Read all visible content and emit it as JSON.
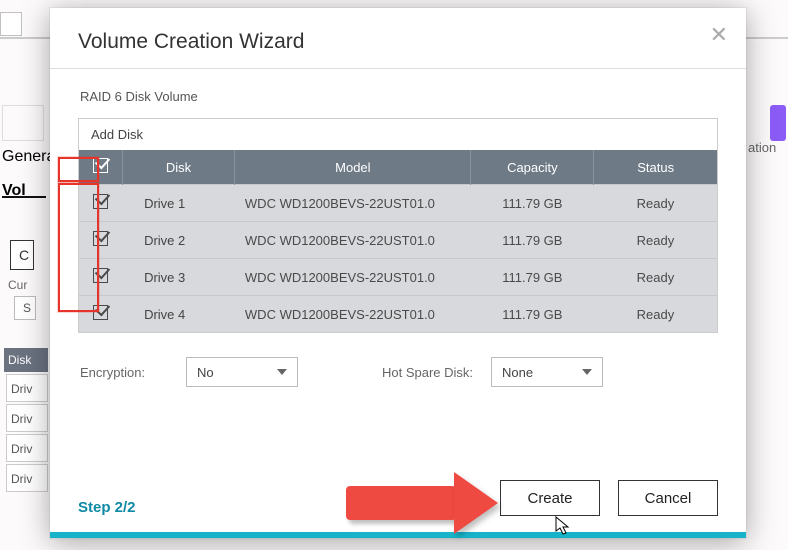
{
  "modal": {
    "title": "Volume Creation Wizard",
    "subtitle": "RAID 6 Disk Volume",
    "add_disk_label": "Add Disk",
    "columns": {
      "disk": "Disk",
      "model": "Model",
      "capacity": "Capacity",
      "status": "Status"
    },
    "drives": [
      {
        "checked": true,
        "name": "Drive 1",
        "model": "WDC WD1200BEVS-22UST01.0",
        "capacity": "111.79 GB",
        "status": "Ready"
      },
      {
        "checked": true,
        "name": "Drive 2",
        "model": "WDC WD1200BEVS-22UST01.0",
        "capacity": "111.79 GB",
        "status": "Ready"
      },
      {
        "checked": true,
        "name": "Drive 3",
        "model": "WDC WD1200BEVS-22UST01.0",
        "capacity": "111.79 GB",
        "status": "Ready"
      },
      {
        "checked": true,
        "name": "Drive 4",
        "model": "WDC WD1200BEVS-22UST01.0",
        "capacity": "111.79 GB",
        "status": "Ready"
      }
    ],
    "options": {
      "encryption_label": "Encryption:",
      "encryption_value": "No",
      "hotspare_label": "Hot Spare Disk:",
      "hotspare_value": "None"
    },
    "step_label": "Step 2/2",
    "buttons": {
      "create": "Create",
      "cancel": "Cancel"
    },
    "header_checked": true
  },
  "background": {
    "left_labels": {
      "general": "Genera",
      "vol": "Vol",
      "c_btn": "C",
      "cur": "Cur",
      "s_btn": "S",
      "disk": "Disk"
    },
    "right_label": "ation",
    "drive_rows": [
      "Driv",
      "Driv",
      "Driv",
      "Driv"
    ]
  },
  "annotations": {
    "highlight_checkbox_column": true,
    "arrow_to_create": true
  },
  "colors": {
    "accent_teal": "#16b3c9",
    "arrow_red": "#ef4a42",
    "highlight_red": "#e6342a",
    "header_gray": "#6e7a86"
  }
}
